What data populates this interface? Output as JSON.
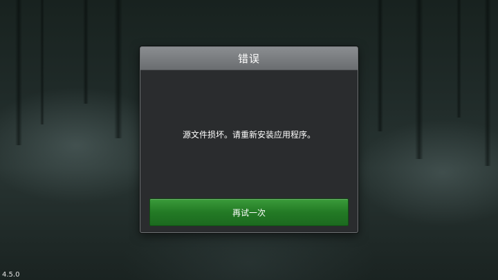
{
  "dialog": {
    "title": "错误",
    "message": "源文件损坏。请重新安装应用程序。",
    "retry_label": "再试一次"
  },
  "version": "4.5.0",
  "colors": {
    "header": "#7a7d80",
    "panel": "#2a2c2e",
    "button": "#237a25"
  }
}
